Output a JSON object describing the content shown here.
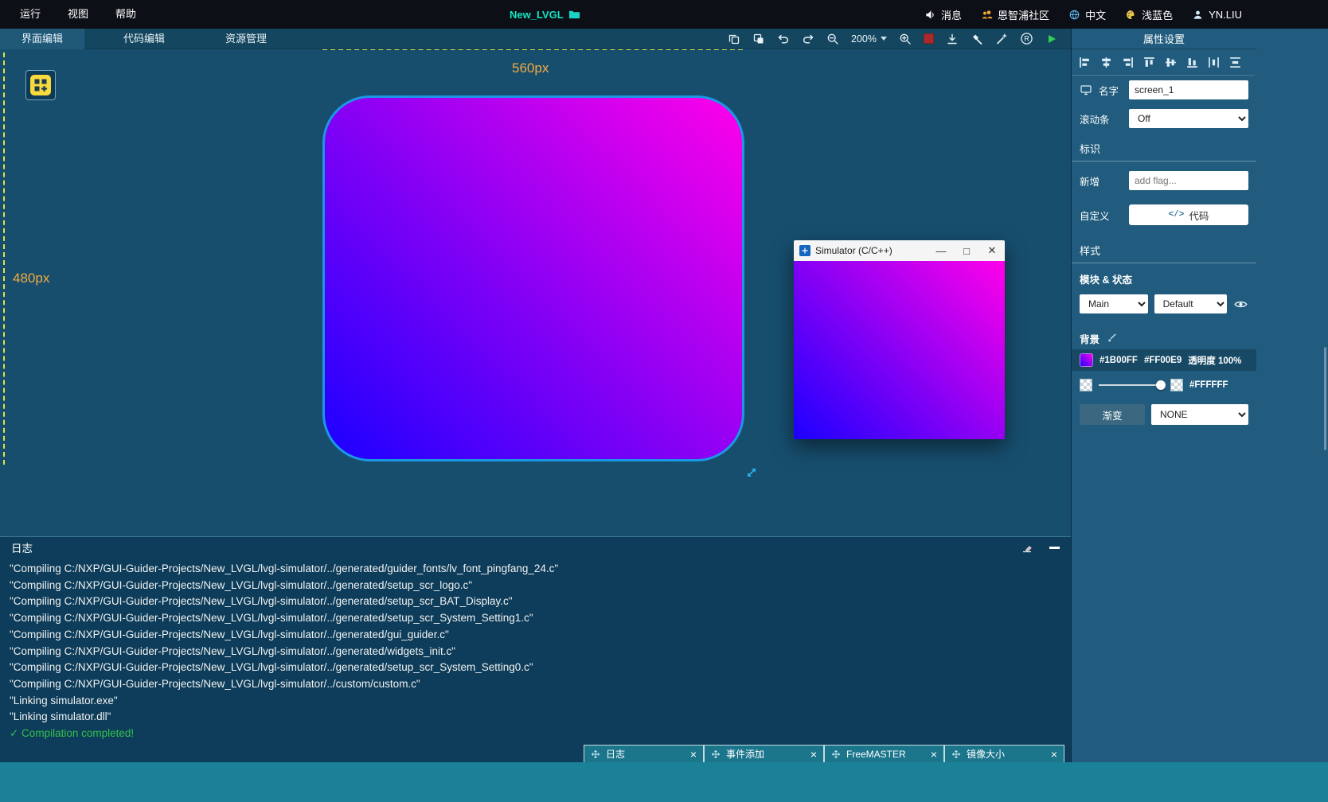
{
  "menubar": {
    "menus": [
      "运行",
      "视图",
      "帮助"
    ],
    "title": "New_LVGL",
    "messages": "消息",
    "community": "恩智浦社区",
    "language": "中文",
    "theme": "浅蓝色",
    "user": "YN.LIU"
  },
  "toolbar": {
    "tab_ui": "界面编辑",
    "tab_code": "代码编辑",
    "tab_resource": "资源管理",
    "zoom": "200%"
  },
  "canvas": {
    "width_label": "560px",
    "height_label": "480px"
  },
  "simulator": {
    "title": "Simulator (C/C++)"
  },
  "log": {
    "title": "日志",
    "lines": [
      "\"Compiling C:/NXP/GUI-Guider-Projects/New_LVGL/lvgl-simulator/../generated/guider_fonts/lv_font_pingfang_24.c\"",
      "\"Compiling C:/NXP/GUI-Guider-Projects/New_LVGL/lvgl-simulator/../generated/setup_scr_logo.c\"",
      "\"Compiling C:/NXP/GUI-Guider-Projects/New_LVGL/lvgl-simulator/../generated/setup_scr_BAT_Display.c\"",
      "\"Compiling C:/NXP/GUI-Guider-Projects/New_LVGL/lvgl-simulator/../generated/setup_scr_System_Setting1.c\"",
      "\"Compiling C:/NXP/GUI-Guider-Projects/New_LVGL/lvgl-simulator/../generated/gui_guider.c\"",
      "\"Compiling C:/NXP/GUI-Guider-Projects/New_LVGL/lvgl-simulator/../generated/widgets_init.c\"",
      "\"Compiling C:/NXP/GUI-Guider-Projects/New_LVGL/lvgl-simulator/../generated/setup_scr_System_Setting0.c\"",
      "\"Compiling C:/NXP/GUI-Guider-Projects/New_LVGL/lvgl-simulator/../custom/custom.c\"",
      "\"Linking simulator.exe\"",
      "\"Linking simulator.dll\""
    ],
    "success": "✓ Compilation completed!"
  },
  "dock_tabs": [
    "日志",
    "事件添加",
    "FreeMASTER",
    "镜像大小"
  ],
  "properties": {
    "title": "属性设置",
    "name_label": "名字",
    "name_value": "screen_1",
    "scrollbar_label": "滚动条",
    "scrollbar_value": "Off",
    "flags_section": "标识",
    "add_label": "新增",
    "add_placeholder": "add flag...",
    "custom_label": "自定义",
    "code_button": "代码",
    "style_section": "样式",
    "module_state_label": "模块 & 状态",
    "module_value": "Main",
    "state_value": "Default",
    "background_label": "背景",
    "bg_color1": "#1B00FF",
    "bg_color2": "#FF00E9",
    "opacity_label": "透明度 100%",
    "gradient_label": "渐变",
    "gradient_hex": "#FFFFFF",
    "gradient_dir": "NONE"
  },
  "colors": {
    "screen_gradient_start": "#1B00FF",
    "screen_gradient_end": "#FF00E9",
    "selection_accent": "#1B97E4",
    "guide_yellow": "#DCE24F",
    "dimension_label": "#F2AB3E",
    "success_green": "#35C04B"
  }
}
